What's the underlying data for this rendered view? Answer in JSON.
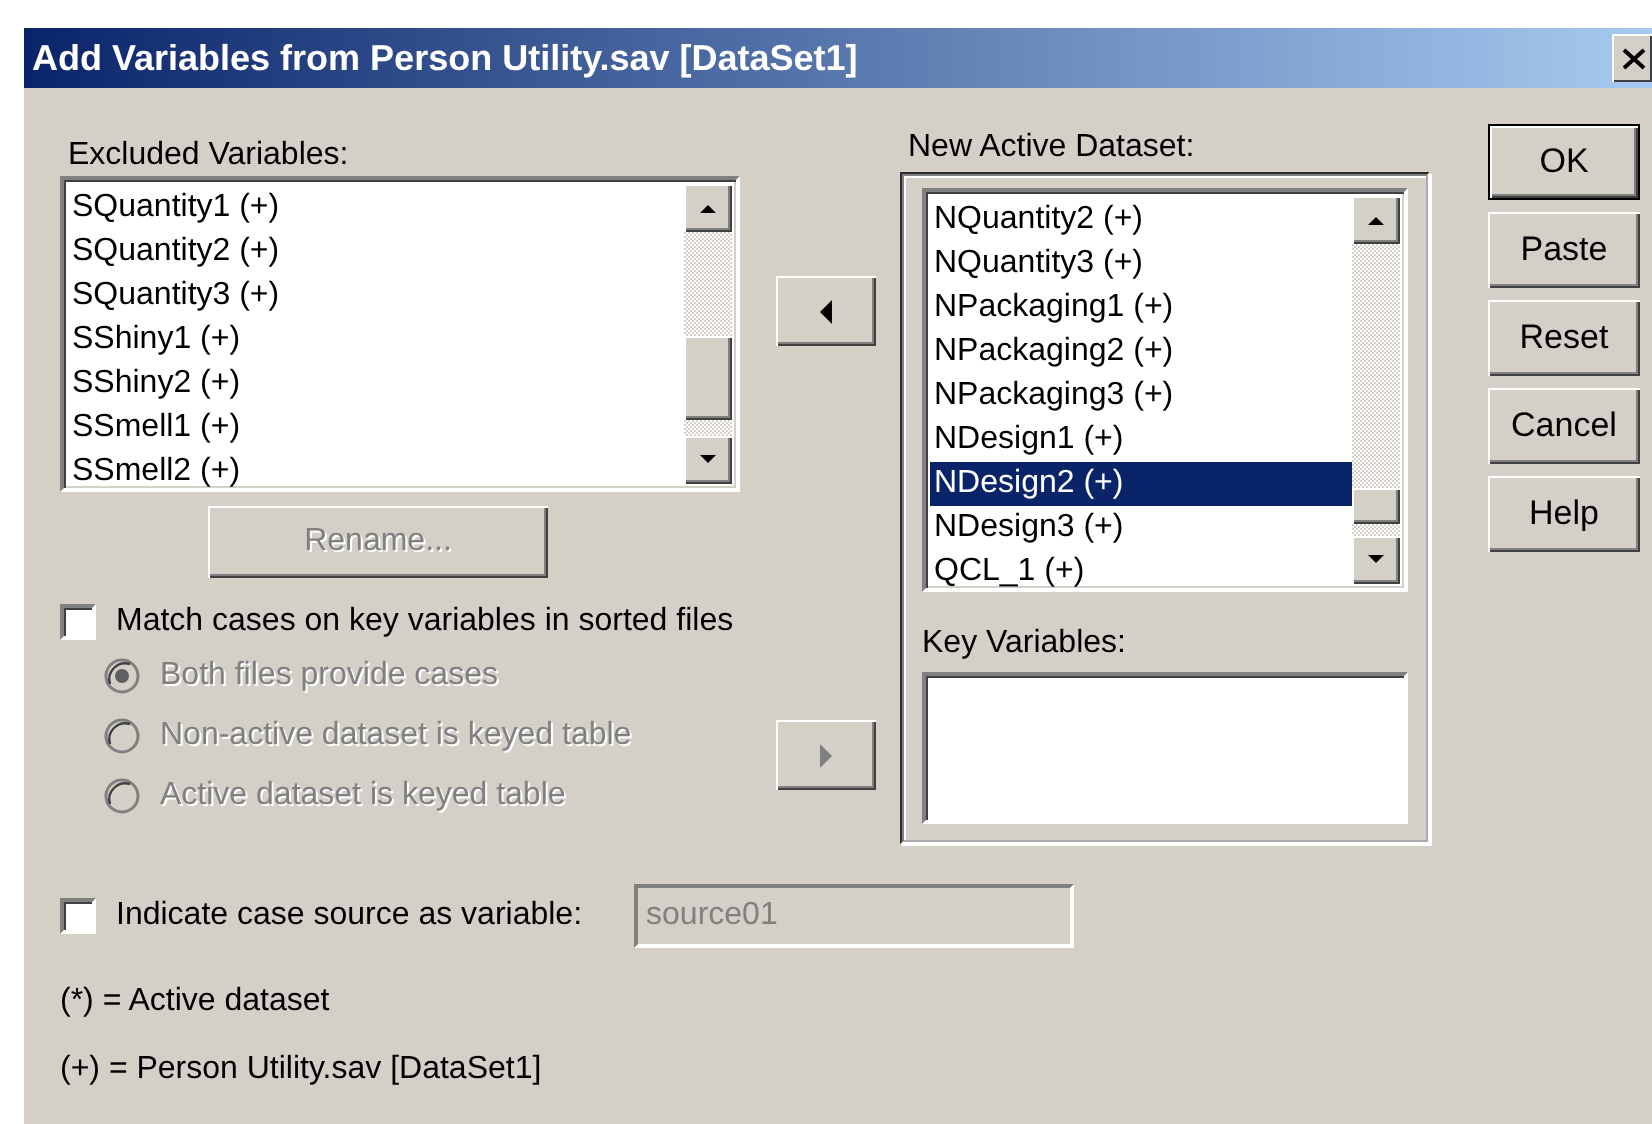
{
  "window": {
    "title": "Add Variables from Person Utility.sav [DataSet1]"
  },
  "excluded": {
    "label": "Excluded Variables:",
    "items": [
      {
        "text": "SQuantity1 (+)",
        "selected": false
      },
      {
        "text": "SQuantity2 (+)",
        "selected": false
      },
      {
        "text": "SQuantity3 (+)",
        "selected": false
      },
      {
        "text": "SShiny1 (+)",
        "selected": false
      },
      {
        "text": "SShiny2 (+)",
        "selected": false
      },
      {
        "text": "SSmell1 (+)",
        "selected": false
      },
      {
        "text": "SSmell2 (+)",
        "selected": false
      }
    ]
  },
  "arrow_buttons": [
    {
      "kind": "left",
      "disabled": false
    },
    {
      "kind": "right",
      "disabled": true
    }
  ],
  "rename_button": {
    "label": "Rename...",
    "disabled": true
  },
  "match_cases": {
    "label": "Match cases on key variables in sorted files",
    "checked": false
  },
  "match_options": [
    {
      "label": "Both files provide cases",
      "selected": true,
      "disabled": true
    },
    {
      "label": "Non-active dataset is keyed table",
      "selected": false,
      "disabled": true
    },
    {
      "label": "Active dataset is keyed table",
      "selected": false,
      "disabled": true
    }
  ],
  "active_dataset": {
    "label": "New Active Dataset:",
    "items": [
      {
        "text": "NQuantity2 (+)",
        "selected": false
      },
      {
        "text": "NQuantity3 (+)",
        "selected": false
      },
      {
        "text": "NPackaging1 (+)",
        "selected": false
      },
      {
        "text": "NPackaging2 (+)",
        "selected": false
      },
      {
        "text": "NPackaging3 (+)",
        "selected": false
      },
      {
        "text": "NDesign1 (+)",
        "selected": false
      },
      {
        "text": "NDesign2 (+)",
        "selected": true
      },
      {
        "text": "NDesign3 (+)",
        "selected": false
      },
      {
        "text": "QCL_1 (+)",
        "selected": false
      }
    ]
  },
  "key_variables": {
    "label": "Key Variables:"
  },
  "buttons": [
    {
      "label": "OK",
      "default": true
    },
    {
      "label": "Paste",
      "default": false
    },
    {
      "label": "Reset",
      "default": false
    },
    {
      "label": "Cancel",
      "default": false
    },
    {
      "label": "Help",
      "default": false
    }
  ],
  "case_source": {
    "label": "Indicate case source as variable:",
    "checked": false,
    "value": "source01",
    "disabled": true
  },
  "legend": [
    "(*) = Active dataset",
    "(+) = Person Utility.sav [DataSet1]"
  ]
}
